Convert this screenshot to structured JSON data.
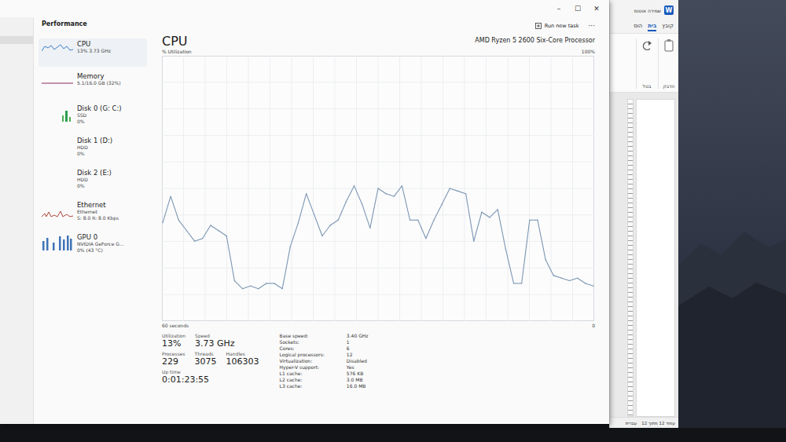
{
  "task_manager": {
    "title": "Performance",
    "controls": [
      "–",
      "☐",
      "✕"
    ],
    "run_new_task": "Run new task",
    "more": "···",
    "sidebar": {
      "items": [
        {
          "name": "CPU",
          "lines": [
            "13% 3.73 GHz"
          ],
          "kind": "cpu",
          "selected": true
        },
        {
          "name": "Memory",
          "lines": [
            "5.1/16.0 GB (32%)"
          ],
          "kind": "memory",
          "selected": false
        },
        {
          "name": "Disk 0 (G: C:)",
          "lines": [
            "SSD",
            "0%"
          ],
          "kind": "disk",
          "selected": false
        },
        {
          "name": "Disk 1 (D:)",
          "lines": [
            "HDD",
            "0%"
          ],
          "kind": "empty",
          "selected": false
        },
        {
          "name": "Disk 2 (E:)",
          "lines": [
            "HDD",
            "0%"
          ],
          "kind": "empty",
          "selected": false
        },
        {
          "name": "Ethernet",
          "lines": [
            "Ethernet",
            "S: 8.0 R: 8.0 Kbps"
          ],
          "kind": "ethernet",
          "selected": false
        },
        {
          "name": "GPU 0",
          "lines": [
            "NVIDIA GeForce G...",
            "0% (43 °C)"
          ],
          "kind": "gpu",
          "selected": false
        }
      ]
    },
    "main": {
      "title": "CPU",
      "subtitle": "% Utilization",
      "processor": "AMD Ryzen 5 2600 Six-Core Processor",
      "max": "100%",
      "min": "0",
      "time_span": "60 seconds",
      "chart": {
        "values": [
          37,
          47,
          38,
          34,
          30,
          31,
          36,
          34,
          32,
          15,
          12,
          13,
          12,
          14,
          14,
          12,
          28,
          37,
          48,
          40,
          32,
          36,
          38,
          45,
          51,
          44,
          35,
          50,
          48,
          47,
          51,
          38,
          38,
          31,
          38,
          44,
          50,
          49,
          48,
          30,
          41,
          39,
          42,
          27,
          14,
          14,
          38,
          38,
          23,
          17,
          16,
          15,
          16,
          14,
          13
        ]
      },
      "stats": [
        [
          {
            "label": "Utilization",
            "value": "13%"
          },
          {
            "label": "Speed",
            "value": "3.73 GHz"
          }
        ],
        [
          {
            "label": "Processes",
            "value": "229"
          },
          {
            "label": "Threads",
            "value": "3075"
          },
          {
            "label": "Handles",
            "value": "106303"
          }
        ],
        [
          {
            "label": "Up time",
            "value": "0:01:23:55"
          }
        ]
      ],
      "specs": [
        {
          "label": "Base speed:",
          "value": "3.40 GHz"
        },
        {
          "label": "Sockets:",
          "value": "1"
        },
        {
          "label": "Cores:",
          "value": "6"
        },
        {
          "label": "Logical processors:",
          "value": "12"
        },
        {
          "label": "Virtualization:",
          "value": "Disabled"
        },
        {
          "label": "Hyper-V support:",
          "value": "Yes"
        },
        {
          "label": "L1 cache:",
          "value": "576 KB"
        },
        {
          "label": "L2 cache:",
          "value": "3.0 MB"
        },
        {
          "label": "L3 cache:",
          "value": "16.0 MB"
        }
      ]
    }
  },
  "word": {
    "title": "שמירה אוטומ",
    "app_icon": "W",
    "tabs": [
      {
        "label": "קובץ",
        "selected": false
      },
      {
        "label": "בית",
        "selected": true
      },
      {
        "label": "הוס",
        "selected": false
      }
    ],
    "ribbon_groups": [
      "הדבק",
      "בטל"
    ],
    "status_bar": [
      "עמוד 12 מתוך 12",
      "עברית"
    ]
  }
}
